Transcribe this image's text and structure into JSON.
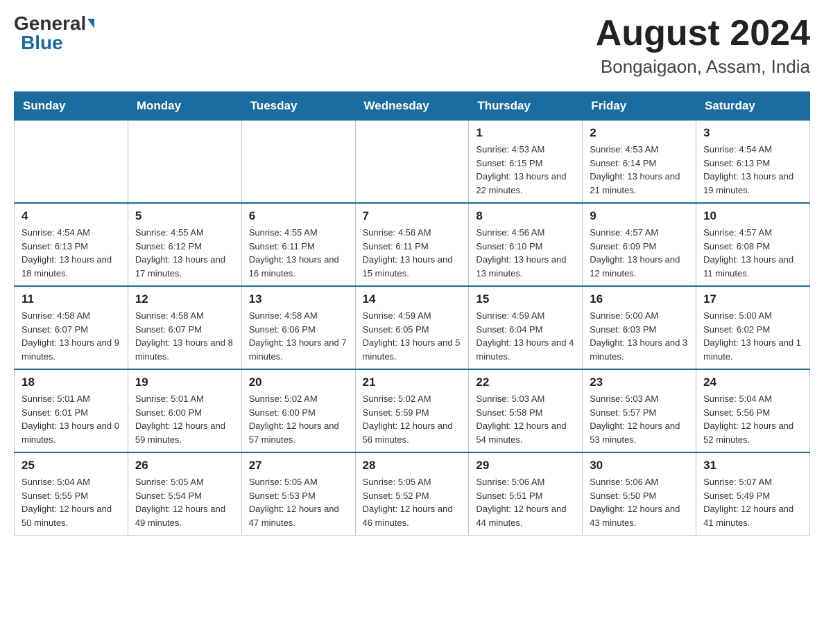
{
  "header": {
    "logo_general": "General",
    "logo_blue": "Blue",
    "title": "August 2024",
    "subtitle": "Bongaigaon, Assam, India"
  },
  "days_of_week": [
    "Sunday",
    "Monday",
    "Tuesday",
    "Wednesday",
    "Thursday",
    "Friday",
    "Saturday"
  ],
  "weeks": [
    {
      "days": [
        {
          "number": "",
          "info": ""
        },
        {
          "number": "",
          "info": ""
        },
        {
          "number": "",
          "info": ""
        },
        {
          "number": "",
          "info": ""
        },
        {
          "number": "1",
          "info": "Sunrise: 4:53 AM\nSunset: 6:15 PM\nDaylight: 13 hours and 22 minutes."
        },
        {
          "number": "2",
          "info": "Sunrise: 4:53 AM\nSunset: 6:14 PM\nDaylight: 13 hours and 21 minutes."
        },
        {
          "number": "3",
          "info": "Sunrise: 4:54 AM\nSunset: 6:13 PM\nDaylight: 13 hours and 19 minutes."
        }
      ]
    },
    {
      "days": [
        {
          "number": "4",
          "info": "Sunrise: 4:54 AM\nSunset: 6:13 PM\nDaylight: 13 hours and 18 minutes."
        },
        {
          "number": "5",
          "info": "Sunrise: 4:55 AM\nSunset: 6:12 PM\nDaylight: 13 hours and 17 minutes."
        },
        {
          "number": "6",
          "info": "Sunrise: 4:55 AM\nSunset: 6:11 PM\nDaylight: 13 hours and 16 minutes."
        },
        {
          "number": "7",
          "info": "Sunrise: 4:56 AM\nSunset: 6:11 PM\nDaylight: 13 hours and 15 minutes."
        },
        {
          "number": "8",
          "info": "Sunrise: 4:56 AM\nSunset: 6:10 PM\nDaylight: 13 hours and 13 minutes."
        },
        {
          "number": "9",
          "info": "Sunrise: 4:57 AM\nSunset: 6:09 PM\nDaylight: 13 hours and 12 minutes."
        },
        {
          "number": "10",
          "info": "Sunrise: 4:57 AM\nSunset: 6:08 PM\nDaylight: 13 hours and 11 minutes."
        }
      ]
    },
    {
      "days": [
        {
          "number": "11",
          "info": "Sunrise: 4:58 AM\nSunset: 6:07 PM\nDaylight: 13 hours and 9 minutes."
        },
        {
          "number": "12",
          "info": "Sunrise: 4:58 AM\nSunset: 6:07 PM\nDaylight: 13 hours and 8 minutes."
        },
        {
          "number": "13",
          "info": "Sunrise: 4:58 AM\nSunset: 6:06 PM\nDaylight: 13 hours and 7 minutes."
        },
        {
          "number": "14",
          "info": "Sunrise: 4:59 AM\nSunset: 6:05 PM\nDaylight: 13 hours and 5 minutes."
        },
        {
          "number": "15",
          "info": "Sunrise: 4:59 AM\nSunset: 6:04 PM\nDaylight: 13 hours and 4 minutes."
        },
        {
          "number": "16",
          "info": "Sunrise: 5:00 AM\nSunset: 6:03 PM\nDaylight: 13 hours and 3 minutes."
        },
        {
          "number": "17",
          "info": "Sunrise: 5:00 AM\nSunset: 6:02 PM\nDaylight: 13 hours and 1 minute."
        }
      ]
    },
    {
      "days": [
        {
          "number": "18",
          "info": "Sunrise: 5:01 AM\nSunset: 6:01 PM\nDaylight: 13 hours and 0 minutes."
        },
        {
          "number": "19",
          "info": "Sunrise: 5:01 AM\nSunset: 6:00 PM\nDaylight: 12 hours and 59 minutes."
        },
        {
          "number": "20",
          "info": "Sunrise: 5:02 AM\nSunset: 6:00 PM\nDaylight: 12 hours and 57 minutes."
        },
        {
          "number": "21",
          "info": "Sunrise: 5:02 AM\nSunset: 5:59 PM\nDaylight: 12 hours and 56 minutes."
        },
        {
          "number": "22",
          "info": "Sunrise: 5:03 AM\nSunset: 5:58 PM\nDaylight: 12 hours and 54 minutes."
        },
        {
          "number": "23",
          "info": "Sunrise: 5:03 AM\nSunset: 5:57 PM\nDaylight: 12 hours and 53 minutes."
        },
        {
          "number": "24",
          "info": "Sunrise: 5:04 AM\nSunset: 5:56 PM\nDaylight: 12 hours and 52 minutes."
        }
      ]
    },
    {
      "days": [
        {
          "number": "25",
          "info": "Sunrise: 5:04 AM\nSunset: 5:55 PM\nDaylight: 12 hours and 50 minutes."
        },
        {
          "number": "26",
          "info": "Sunrise: 5:05 AM\nSunset: 5:54 PM\nDaylight: 12 hours and 49 minutes."
        },
        {
          "number": "27",
          "info": "Sunrise: 5:05 AM\nSunset: 5:53 PM\nDaylight: 12 hours and 47 minutes."
        },
        {
          "number": "28",
          "info": "Sunrise: 5:05 AM\nSunset: 5:52 PM\nDaylight: 12 hours and 46 minutes."
        },
        {
          "number": "29",
          "info": "Sunrise: 5:06 AM\nSunset: 5:51 PM\nDaylight: 12 hours and 44 minutes."
        },
        {
          "number": "30",
          "info": "Sunrise: 5:06 AM\nSunset: 5:50 PM\nDaylight: 12 hours and 43 minutes."
        },
        {
          "number": "31",
          "info": "Sunrise: 5:07 AM\nSunset: 5:49 PM\nDaylight: 12 hours and 41 minutes."
        }
      ]
    }
  ]
}
